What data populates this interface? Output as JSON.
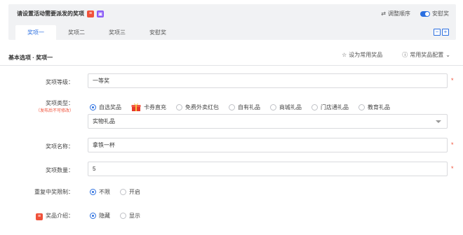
{
  "header": {
    "title": "请设置活动需要派发的奖项",
    "adjust_order": "调整顺序",
    "consolation_toggle_label": "安慰奖",
    "consolation_enabled": true
  },
  "tabs": [
    {
      "label": "奖项一",
      "active": true
    },
    {
      "label": "奖项二",
      "active": false
    },
    {
      "label": "奖项三",
      "active": false
    },
    {
      "label": "安慰奖",
      "active": false
    }
  ],
  "tab_buttons": {
    "remove": "−",
    "add": "+"
  },
  "section": {
    "title": "基本选项 · 奖项一",
    "set_common": "设为常用奖品",
    "common_config": "常用奖品配置"
  },
  "form": {
    "level": {
      "label": "奖项等级：",
      "value": "一等奖"
    },
    "type": {
      "label": "奖项类型：",
      "sublabel": "（发布后不可修改）",
      "options": [
        "自选奖品",
        "卡券直充",
        "免费外卖红包",
        "自有礼品",
        "商城礼品",
        "门店通礼品",
        "教育礼品"
      ],
      "selected": "自选奖品",
      "sub_select_value": "实物礼品"
    },
    "name": {
      "label": "奖项名称：",
      "value": "拿铁一杯"
    },
    "quantity": {
      "label": "奖项数量：",
      "value": "5"
    },
    "repeat_limit": {
      "label": "重复中奖限制：",
      "options": [
        "不限",
        "开启"
      ],
      "selected": "不限"
    },
    "intro": {
      "label": "奖品介绍：",
      "options": [
        "隐藏",
        "显示"
      ],
      "selected": "隐藏"
    }
  },
  "colors": {
    "accent": "#2b6fe0",
    "danger": "#f0513a",
    "badge_purple": "#8b5cf6"
  }
}
